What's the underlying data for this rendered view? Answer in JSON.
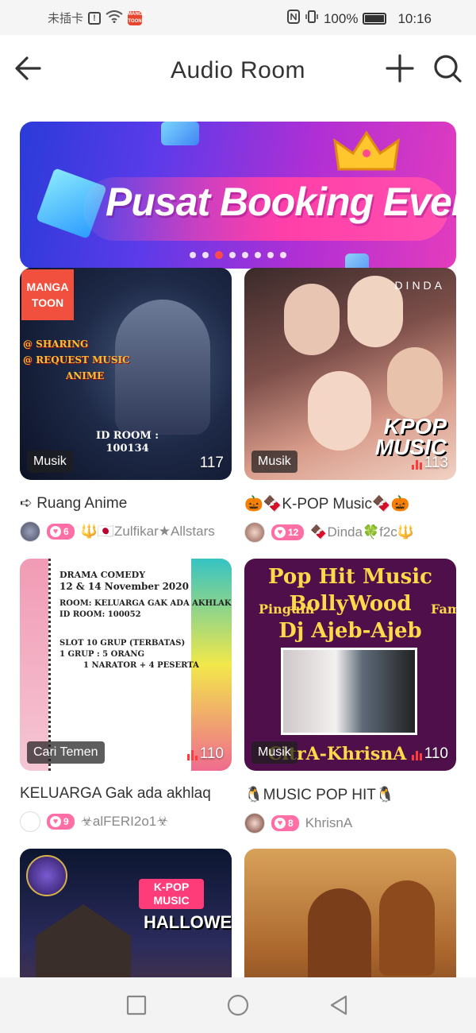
{
  "status_bar": {
    "carrier": "未插卡",
    "alert_mark": "!",
    "app_badge": "MANGA TOON",
    "battery": "100%",
    "time": "10:16"
  },
  "header": {
    "title": "Audio Room"
  },
  "banner": {
    "title": "Pusat Booking Event",
    "slide_count": 8,
    "active_slide": 3
  },
  "rooms": [
    {
      "name": "➪ Ruang Anime",
      "tag": "Musik",
      "count": "117",
      "likes": "6",
      "owner": "🔱🇯🇵Zulfikar★Allstars",
      "art_text": [
        "MANGA",
        "TOON",
        "@ SHARING",
        "@ REQUEST MUSIC",
        "ANIME",
        "ID ROOM :",
        "100134"
      ]
    },
    {
      "name": "🎃🍫K-POP Music🍫🎃",
      "tag": "Musik",
      "count": "113",
      "likes": "12",
      "owner": "🍫Dinda🍀f2c🔱",
      "art_text": [
        "DINDA",
        "KPOP",
        "MUSIC"
      ]
    },
    {
      "name": "KELUARGA Gak ada akhlaq",
      "tag": "Cari Temen",
      "count": "110",
      "likes": "9",
      "owner": "☣alFERI2o1☣",
      "art_text": [
        "DRAMA COMEDY",
        "12 & 14 November 2020",
        "ROOM: KELUARGA GAK ADA AKHLAK",
        "ID ROOM: 100052",
        "SLOT 10 GRUP (TERBATAS)",
        "1 GRUP : 5 ORANG",
        "1 NARATOR + 4 PESERTA"
      ]
    },
    {
      "name": "🐧MUSIC POP HIT🐧",
      "tag": "Musik",
      "count": "110",
      "likes": "8",
      "owner": "KhrisnA",
      "art_text": [
        "Pop Hit Music",
        "BollyWood",
        "Dj Ajeb-Ajeb",
        "Pinguin",
        "Family",
        "CitrA-KhrisnA"
      ]
    },
    {
      "name": "",
      "tag": "",
      "count": "",
      "likes": "",
      "owner": "",
      "art_text": [
        "K-POP",
        "MUSIC",
        "HALLOWEEN"
      ]
    },
    {
      "name": "",
      "tag": "",
      "count": "",
      "likes": "",
      "owner": "",
      "art_text": []
    }
  ],
  "colors": {
    "like_pill": "#ff6fa5",
    "active_dot": "#ff4a4a",
    "live_bars": "#ff3b3b"
  }
}
